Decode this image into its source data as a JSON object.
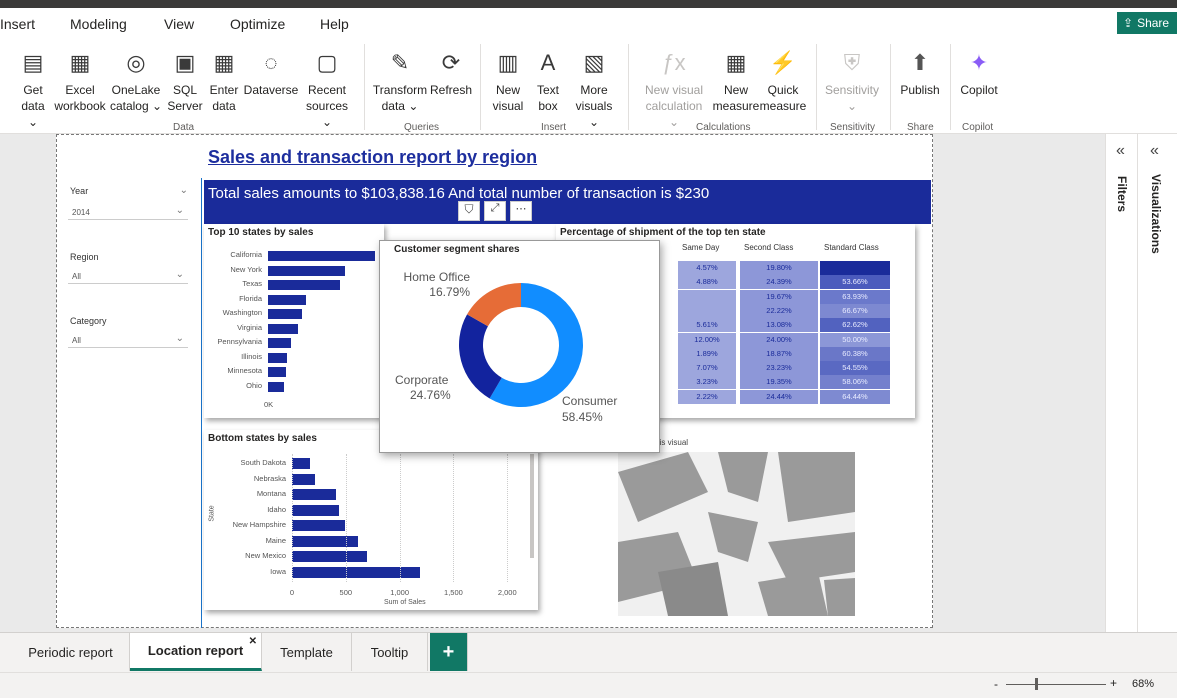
{
  "menu": {
    "items": [
      "Insert",
      "Modeling",
      "View",
      "Optimize",
      "Help"
    ],
    "share": "Share"
  },
  "ribbon": {
    "buttons": [
      {
        "l1": "Get",
        "l2": "data ⌄"
      },
      {
        "l1": "Excel",
        "l2": "workbook"
      },
      {
        "l1": "OneLake",
        "l2": "catalog ⌄"
      },
      {
        "l1": "SQL",
        "l2": "Server"
      },
      {
        "l1": "Enter",
        "l2": "data"
      },
      {
        "l1": "Dataverse",
        "l2": ""
      },
      {
        "l1": "Recent",
        "l2": "sources ⌄"
      },
      {
        "l1": "Transform",
        "l2": "data ⌄"
      },
      {
        "l1": "Refresh",
        "l2": ""
      },
      {
        "l1": "New",
        "l2": "visual"
      },
      {
        "l1": "Text",
        "l2": "box"
      },
      {
        "l1": "More",
        "l2": "visuals ⌄"
      },
      {
        "l1": "New visual",
        "l2": "calculation ⌄"
      },
      {
        "l1": "New",
        "l2": "measure"
      },
      {
        "l1": "Quick",
        "l2": "measure"
      },
      {
        "l1": "Sensitivity",
        "l2": "⌄"
      },
      {
        "l1": "Publish",
        "l2": ""
      },
      {
        "l1": "Copilot",
        "l2": ""
      }
    ],
    "groups": [
      "Data",
      "Queries",
      "Insert",
      "Calculations",
      "Sensitivity",
      "Share",
      "Copilot"
    ]
  },
  "slicers": [
    {
      "label": "Year",
      "value": "2014"
    },
    {
      "label": "Region",
      "value": "All"
    },
    {
      "label": "Category",
      "value": "All"
    }
  ],
  "report": {
    "title": "Sales and transaction report by region",
    "banner": "Total sales amounts to $103,838.16 And total number of transaction is $230"
  },
  "top10": {
    "title": "Top 10 states by sales",
    "axis_zero": "0K",
    "chart_data": {
      "type": "bar",
      "categories": [
        "California",
        "New York",
        "Texas",
        "Florida",
        "Washington",
        "Virginia",
        "Pennsylvania",
        "Illinois",
        "Minnesota",
        "Ohio"
      ],
      "values": [
        19500,
        14000,
        13000,
        6900,
        6100,
        5400,
        4200,
        3400,
        3300,
        2900
      ]
    }
  },
  "bottom": {
    "title": "Bottom states by sales",
    "ylabel": "State",
    "xlabel": "Sum of Sales",
    "ticks": [
      "0",
      "500",
      "1,000",
      "1,500",
      "2,000"
    ],
    "chart_data": {
      "type": "bar",
      "categories": [
        "South Dakota",
        "Nebraska",
        "Montana",
        "Idaho",
        "New Hampshire",
        "Maine",
        "New Mexico",
        "Iowa"
      ],
      "values": [
        170,
        210,
        410,
        440,
        490,
        610,
        700,
        1190
      ],
      "xlim": [
        0,
        2100
      ]
    }
  },
  "matrix": {
    "title": "Percentage of shipment of the top ten state",
    "headers": [
      "s",
      "Same Day",
      "Second Class",
      "Standard Class"
    ],
    "rows": [
      [
        "%",
        "4.57%",
        "19.80%",
        ""
      ],
      [
        "%",
        "4.88%",
        "24.39%",
        "53.66%"
      ],
      [
        "%",
        "",
        "19.67%",
        "63.93%"
      ],
      [
        "%",
        "",
        "22.22%",
        "66.67%"
      ],
      [
        "%",
        "5.61%",
        "13.08%",
        "62.62%"
      ],
      [
        "%",
        "12.00%",
        "24.00%",
        "50.00%"
      ],
      [
        "%",
        "1.89%",
        "18.87%",
        "60.38%"
      ],
      [
        "%",
        "7.07%",
        "23.23%",
        "54.55%"
      ],
      [
        "%",
        "3.23%",
        "19.35%",
        "58.06%"
      ],
      [
        "%",
        "2.22%",
        "24.44%",
        "64.44%"
      ]
    ]
  },
  "tooltip": {
    "title": "Customer segment shares",
    "chart_data": {
      "type": "pie",
      "slices": [
        {
          "name": "Consumer",
          "value": 58.45,
          "label": "58.45%",
          "color": "#118dff"
        },
        {
          "name": "Corporate",
          "value": 24.76,
          "label": "24.76%",
          "color": "#12239e"
        },
        {
          "name": "Home Office",
          "value": 16.79,
          "label": "16.79%",
          "color": "#e66c37"
        }
      ]
    }
  },
  "map": {
    "message": "populate this visual"
  },
  "panes": {
    "filters": "Filters",
    "visualizations": "Visualizations"
  },
  "tabs": [
    "Periodic report",
    "Location report",
    "Template",
    "Tooltip"
  ],
  "status": {
    "zoom": "68%"
  }
}
